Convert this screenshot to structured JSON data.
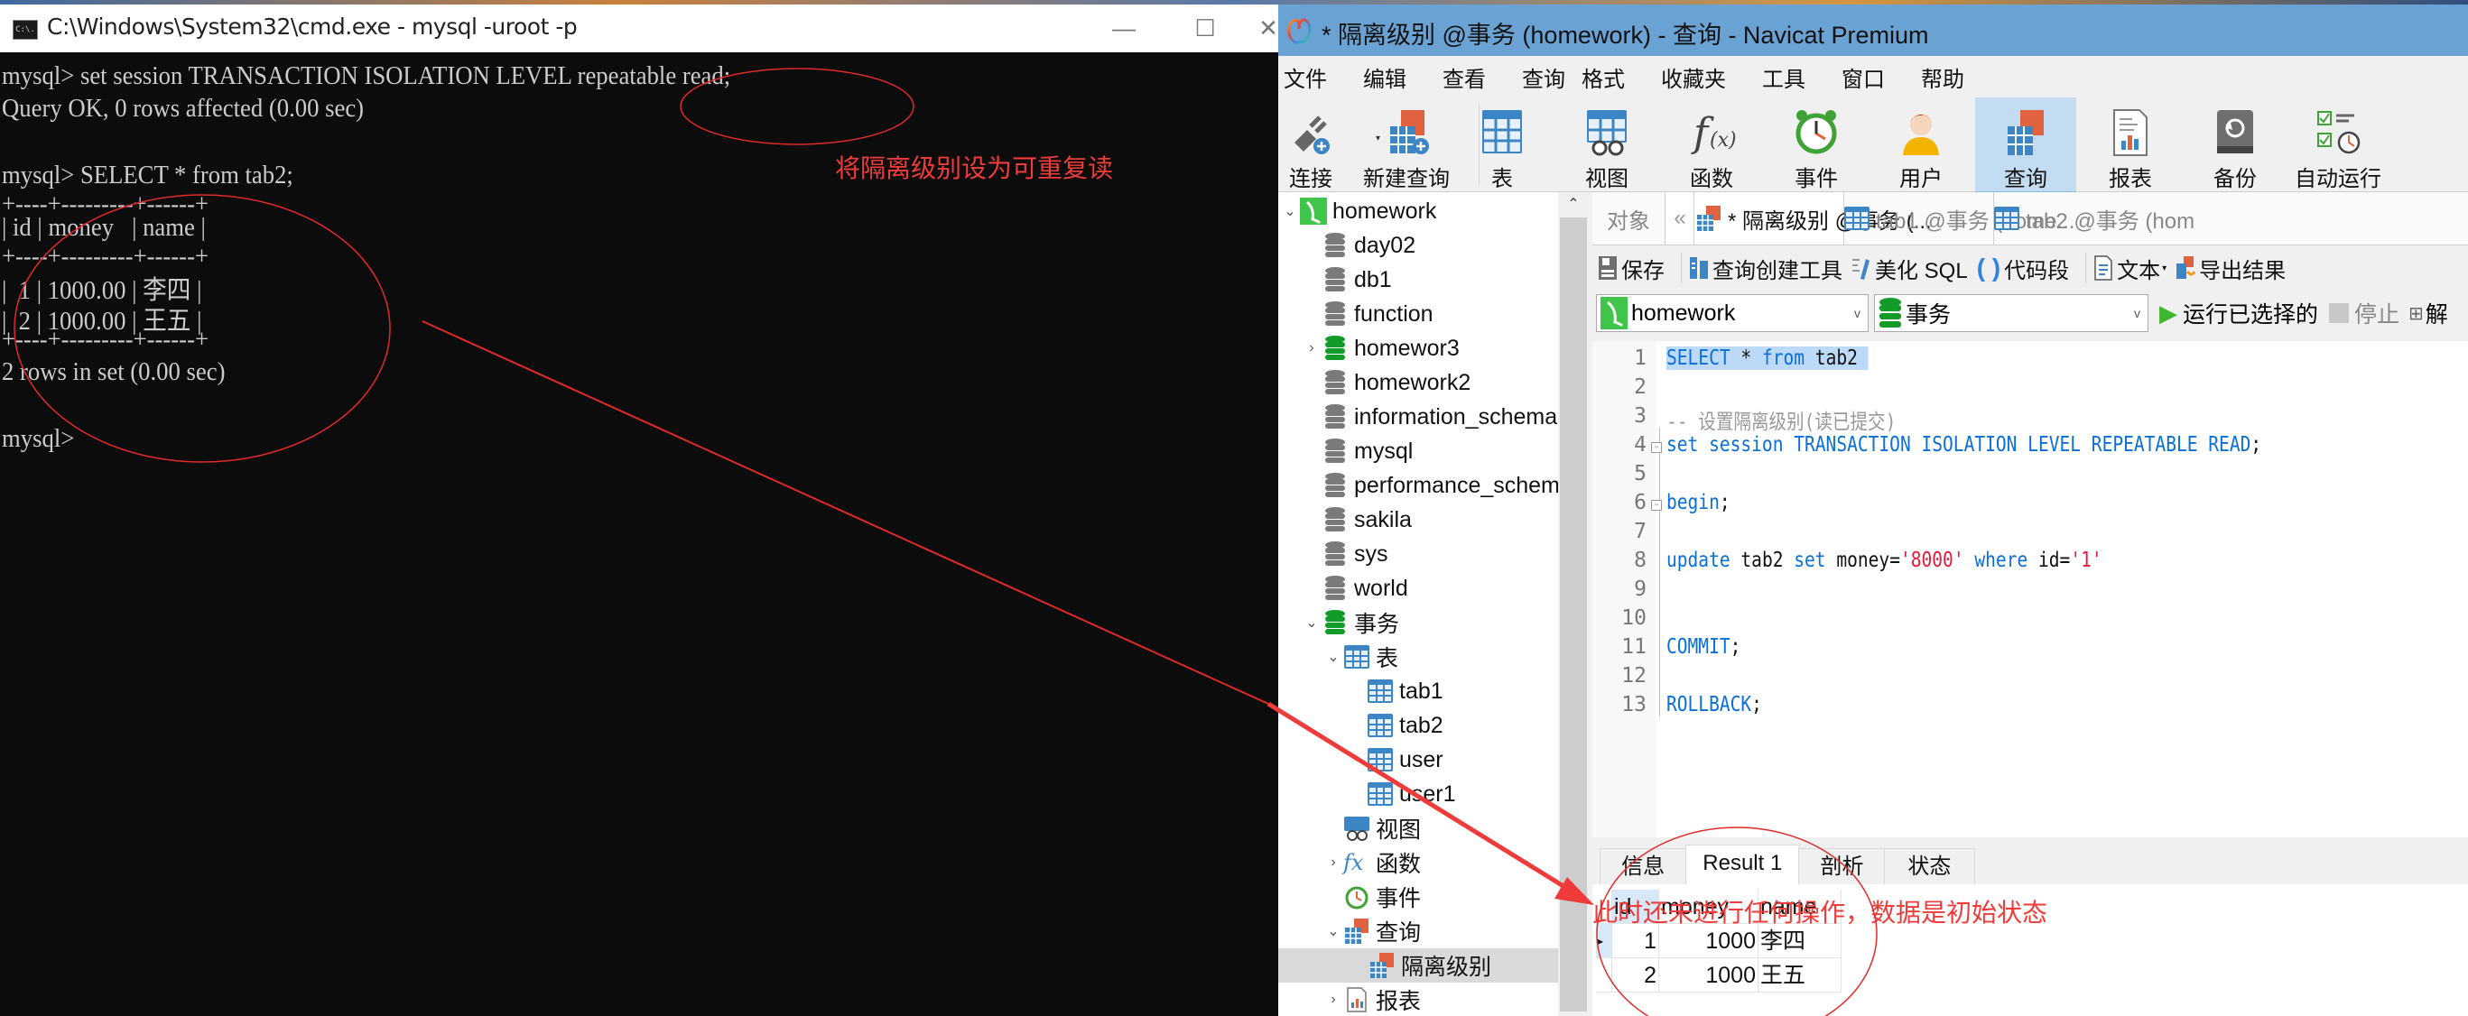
{
  "cmd": {
    "title": "C:\\Windows\\System32\\cmd.exe - mysql  -uroot -p",
    "icon_text": "C:\\.",
    "lines": [
      "mysql> set session TRANSACTION ISOLATION LEVEL repeatable read;",
      "Query OK, 0 rows affected (0.00 sec)",
      "",
      "mysql> SELECT * from tab2;",
      "+----+---------+------+",
      "| id | money   | name |",
      "+----+---------+------+",
      "|  1 | 1000.00 | 李四 |",
      "|  2 | 1000.00 | 王五 |",
      "+----+---------+------+",
      "2 rows in set (0.00 sec)",
      "",
      "mysql>"
    ],
    "window_buttons": {
      "minimize": "—",
      "maximize": "☐",
      "close": "✕"
    }
  },
  "annotations": {
    "cmd_note": "将隔离级别设为可重复读",
    "result_note": "此时还未进行任何操作，数据是初始状态",
    "color": "#f03b3b"
  },
  "navicat": {
    "title": "* 隔离级别 @事务 (homework) - 查询 - Navicat Premium",
    "menu": [
      "文件",
      "编辑",
      "查看",
      "查询",
      "格式",
      "收藏夹",
      "工具",
      "窗口",
      "帮助"
    ],
    "toolbar": [
      {
        "label": "连接",
        "icon": "connection-plug-icon"
      },
      {
        "label": "新建查询",
        "icon": "new-query-icon"
      },
      {
        "label": "表",
        "icon": "table-icon"
      },
      {
        "label": "视图",
        "icon": "view-icon"
      },
      {
        "label": "函数",
        "icon": "function-icon"
      },
      {
        "label": "事件",
        "icon": "event-clock-icon"
      },
      {
        "label": "用户",
        "icon": "user-icon"
      },
      {
        "label": "查询",
        "icon": "query-icon",
        "active": true
      },
      {
        "label": "报表",
        "icon": "report-icon"
      },
      {
        "label": "备份",
        "icon": "backup-icon"
      },
      {
        "label": "自动运行",
        "icon": "automation-icon"
      }
    ],
    "sidebar": {
      "connection": "homework",
      "databases": [
        {
          "name": "day02",
          "color": "gray"
        },
        {
          "name": "db1",
          "color": "gray"
        },
        {
          "name": "function",
          "color": "gray"
        },
        {
          "name": "homewor3",
          "color": "green",
          "collapsed": true
        },
        {
          "name": "homework2",
          "color": "gray"
        },
        {
          "name": "information_schema",
          "color": "gray"
        },
        {
          "name": "mysql",
          "color": "gray"
        },
        {
          "name": "performance_schema",
          "color": "gray"
        },
        {
          "name": "sakila",
          "color": "gray"
        },
        {
          "name": "sys",
          "color": "gray"
        },
        {
          "name": "world",
          "color": "gray"
        }
      ],
      "open_db": "事务",
      "tables_label": "表",
      "tables": [
        "tab1",
        "tab2",
        "user",
        "user1"
      ],
      "views_label": "视图",
      "functions_label": "函数",
      "events_label": "事件",
      "queries_label": "查询",
      "queries": [
        "隔离级别"
      ],
      "reports_label": "报表"
    },
    "tabs": [
      {
        "label": "对象"
      },
      {
        "label": "* 隔离级别 @事务 (...",
        "active": true
      },
      {
        "label": "tab1 @事务 (home..."
      },
      {
        "label": "tab2 @事务 (hom"
      }
    ],
    "query_toolbar": {
      "save": "保存",
      "query_builder": "查询创建工具",
      "beautify": "美化 SQL",
      "snippet": "代码段",
      "text": "文本",
      "export": "导出结果"
    },
    "connection_select": "homework",
    "database_select": "事务",
    "run_selected": "运行已选择的",
    "stop": "停止",
    "explain": "解",
    "editor_lines": [
      {
        "n": "1",
        "tokens": [
          {
            "t": "SELECT",
            "c": "kw"
          },
          {
            "t": " * ",
            "c": ""
          },
          {
            "t": "from",
            "c": "kw"
          },
          {
            "t": " tab2 ",
            "c": ""
          }
        ],
        "highlight": true
      },
      {
        "n": "2",
        "tokens": []
      },
      {
        "n": "3",
        "tokens": [
          {
            "t": "-- 设置隔离级别(读已提交)",
            "c": "cm"
          }
        ]
      },
      {
        "n": "4",
        "tokens": [
          {
            "t": "set session TRANSACTION ISOLATION LEVEL REPEATABLE READ",
            "c": "kw"
          },
          {
            "t": ";",
            "c": ""
          }
        ],
        "fold": true
      },
      {
        "n": "5",
        "tokens": []
      },
      {
        "n": "6",
        "tokens": [
          {
            "t": "begin",
            "c": "kw"
          },
          {
            "t": ";",
            "c": ""
          }
        ],
        "fold": true
      },
      {
        "n": "7",
        "tokens": []
      },
      {
        "n": "8",
        "tokens": [
          {
            "t": "update",
            "c": "kw"
          },
          {
            "t": " tab2 ",
            "c": ""
          },
          {
            "t": "set",
            "c": "kw"
          },
          {
            "t": " money=",
            "c": ""
          },
          {
            "t": "'8000'",
            "c": "str"
          },
          {
            "t": " ",
            "c": ""
          },
          {
            "t": "where",
            "c": "kw"
          },
          {
            "t": " id=",
            "c": ""
          },
          {
            "t": "'1'",
            "c": "str"
          }
        ]
      },
      {
        "n": "9",
        "tokens": []
      },
      {
        "n": "10",
        "tokens": []
      },
      {
        "n": "11",
        "tokens": [
          {
            "t": "COMMIT",
            "c": "kw"
          },
          {
            "t": ";",
            "c": ""
          }
        ]
      },
      {
        "n": "12",
        "tokens": []
      },
      {
        "n": "13",
        "tokens": [
          {
            "t": "ROLLBACK",
            "c": "kw"
          },
          {
            "t": ";",
            "c": ""
          }
        ]
      }
    ],
    "result_tabs": [
      {
        "label": "信息"
      },
      {
        "label": "Result 1",
        "active": true
      },
      {
        "label": "剖析"
      },
      {
        "label": "状态"
      }
    ],
    "result_grid": {
      "columns": [
        "id",
        "money",
        "name"
      ],
      "rows": [
        [
          "1",
          "1000",
          "李四"
        ],
        [
          "2",
          "1000",
          "王五"
        ]
      ]
    }
  }
}
